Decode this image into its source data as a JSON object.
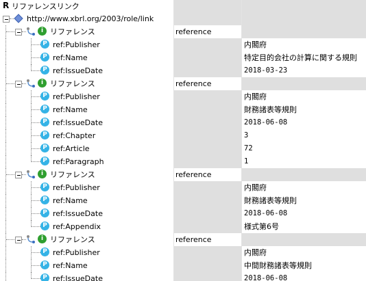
{
  "tree": {
    "root_label": "リファレンスリンク",
    "role_uri": "http://www.xbrl.org/2003/role/link",
    "references": [
      {
        "label": "リファレンス",
        "type": "reference",
        "parts": [
          {
            "name": "ref:Publisher",
            "value": "内閣府"
          },
          {
            "name": "ref:Name",
            "value": "特定目的会社の計算に関する規則"
          },
          {
            "name": "ref:IssueDate",
            "value": "2018-03-23"
          }
        ]
      },
      {
        "label": "リファレンス",
        "type": "reference",
        "parts": [
          {
            "name": "ref:Publisher",
            "value": "内閣府"
          },
          {
            "name": "ref:Name",
            "value": "財務諸表等規則"
          },
          {
            "name": "ref:IssueDate",
            "value": "2018-06-08"
          },
          {
            "name": "ref:Chapter",
            "value": "3"
          },
          {
            "name": "ref:Article",
            "value": "72"
          },
          {
            "name": "ref:Paragraph",
            "value": "1"
          }
        ]
      },
      {
        "label": "リファレンス",
        "type": "reference",
        "parts": [
          {
            "name": "ref:Publisher",
            "value": "内閣府"
          },
          {
            "name": "ref:Name",
            "value": "財務諸表等規則"
          },
          {
            "name": "ref:IssueDate",
            "value": "2018-06-08"
          },
          {
            "name": "ref:Appendix",
            "value": "様式第6号"
          }
        ]
      },
      {
        "label": "リファレンス",
        "type": "reference",
        "parts": [
          {
            "name": "ref:Publisher",
            "value": "内閣府"
          },
          {
            "name": "ref:Name",
            "value": "中間財務諸表等規則"
          },
          {
            "name": "ref:IssueDate",
            "value": "2018-06-08"
          }
        ]
      }
    ]
  },
  "icons": {
    "root": "reference-link-r-icon",
    "role": "blue-diamond-icon",
    "arc": "link-arc-icon",
    "reference": "info-i-icon",
    "part": "property-p-icon"
  },
  "colors": {
    "shaded_column": "#dfdfdf",
    "reference_icon": "#2f9f2f",
    "part_icon": "#35b3e6",
    "role_icon": "#6f8fd8"
  }
}
